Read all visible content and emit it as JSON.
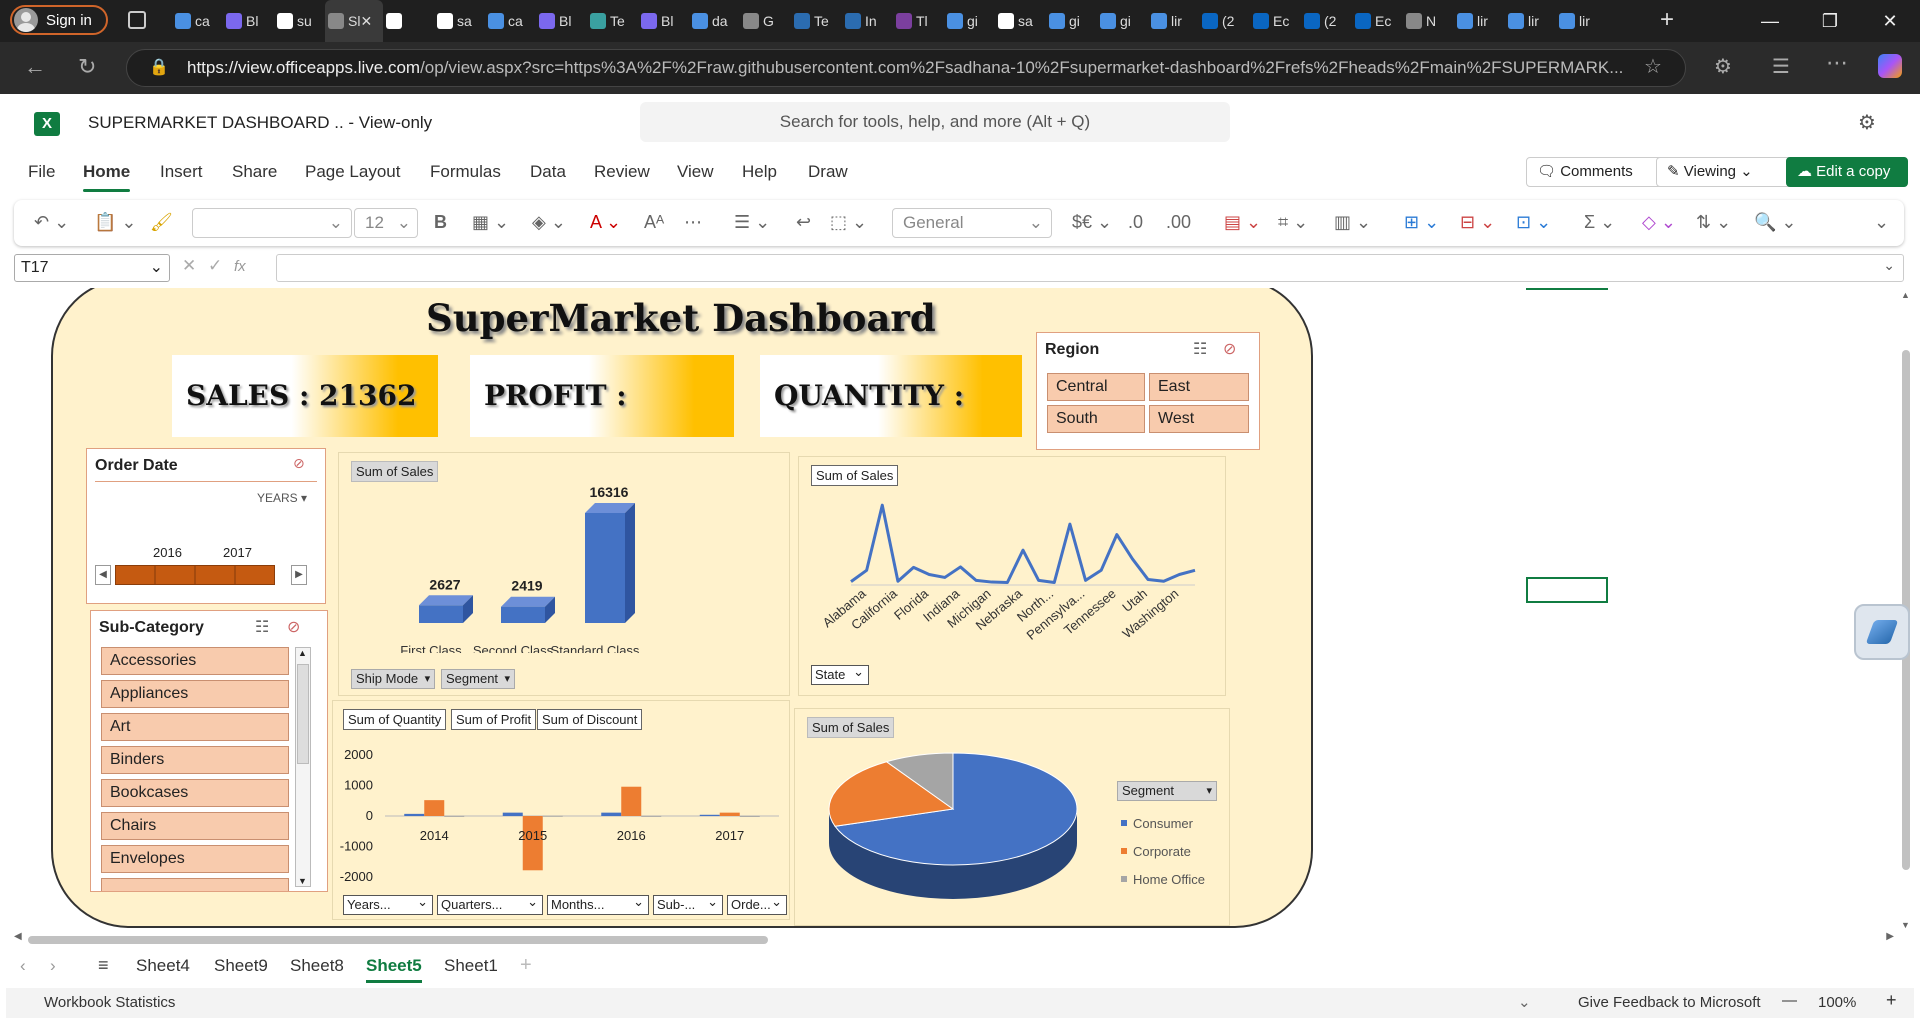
{
  "browser": {
    "signin": "Sign in",
    "tabs": [
      {
        "icon": "search-icon",
        "label": "ca",
        "color": "#4a90e2"
      },
      {
        "icon": "app-icon",
        "label": "Bl",
        "color": "#7b68ee"
      },
      {
        "icon": "github-icon",
        "label": "su",
        "color": "#ffffff"
      },
      {
        "icon": "doc-icon",
        "label": "Sl",
        "color": "#888888",
        "active": true
      },
      {
        "icon": "github-icon",
        "label": "",
        "color": "#ffffff"
      },
      {
        "icon": "github-icon",
        "label": "sa",
        "color": "#ffffff"
      },
      {
        "icon": "search-icon",
        "label": "ca",
        "color": "#4a90e2"
      },
      {
        "icon": "app-icon",
        "label": "Bl",
        "color": "#7b68ee"
      },
      {
        "icon": "app-icon",
        "label": "Te",
        "color": "#3aa0a0"
      },
      {
        "icon": "app-icon",
        "label": "Bl",
        "color": "#7b68ee"
      },
      {
        "icon": "search-icon",
        "label": "da",
        "color": "#4a90e2"
      },
      {
        "icon": "g-icon",
        "label": "G",
        "color": "#888888"
      },
      {
        "icon": "c-icon",
        "label": "Te",
        "color": "#2b6cb0"
      },
      {
        "icon": "c-icon",
        "label": "In",
        "color": "#2b6cb0"
      },
      {
        "icon": "u-icon",
        "label": "Tl",
        "color": "#7b3f9e"
      },
      {
        "icon": "search-icon",
        "label": "gi",
        "color": "#4a90e2"
      },
      {
        "icon": "github-icon",
        "label": "sa",
        "color": "#ffffff"
      },
      {
        "icon": "search-icon",
        "label": "gi",
        "color": "#4a90e2"
      },
      {
        "icon": "search-icon",
        "label": "gi",
        "color": "#4a90e2"
      },
      {
        "icon": "search-icon",
        "label": "lir",
        "color": "#4a90e2"
      },
      {
        "icon": "linkedin-icon",
        "label": "(2",
        "color": "#0a66c2"
      },
      {
        "icon": "linkedin-icon",
        "label": "Ec",
        "color": "#0a66c2"
      },
      {
        "icon": "linkedin-icon",
        "label": "(2",
        "color": "#0a66c2"
      },
      {
        "icon": "linkedin-icon",
        "label": "Ec",
        "color": "#0a66c2"
      },
      {
        "icon": "grid-icon",
        "label": "N",
        "color": "#888888"
      },
      {
        "icon": "search-icon",
        "label": "lir",
        "color": "#4a90e2"
      },
      {
        "icon": "search-icon",
        "label": "lir",
        "color": "#4a90e2"
      },
      {
        "icon": "search-icon",
        "label": "lir",
        "color": "#4a90e2"
      }
    ],
    "url_host": "https://view.officeapps.live.com",
    "url_path": "/op/view.aspx?src=https%3A%2F%2Fraw.githubusercontent.com%2Fsadhana-10%2Fsupermarket-dashboard%2Frefs%2Fheads%2Fmain%2FSUPERMARK..."
  },
  "excel": {
    "title": "SUPERMARKET DASHBOARD ..  -  View-only",
    "search_placeholder": "Search for tools, help, and more (Alt + Q)",
    "menus": [
      "File",
      "Home",
      "Insert",
      "Share",
      "Page Layout",
      "Formulas",
      "Data",
      "Review",
      "View",
      "Help",
      "Draw"
    ],
    "selected_menu": "Home",
    "comments": "Comments",
    "viewing": "Viewing",
    "edit_copy": "Edit a copy",
    "font_size": "12",
    "number_format": "General",
    "currency": "$€",
    "cell_ref": "T17",
    "fx": "fx"
  },
  "dashboard": {
    "title": "SuperMarket Dashboard",
    "kpis": {
      "sales": "SALES :  21362",
      "profit": "PROFIT :",
      "quantity": "QUANTITY :"
    },
    "region": {
      "title": "Region",
      "items": [
        "Central",
        "East",
        "South",
        "West"
      ]
    },
    "order_date": {
      "title": "Order Date",
      "level": "YEARS",
      "years": [
        "2016",
        "2017"
      ]
    },
    "sub_category": {
      "title": "Sub-Category",
      "items": [
        "Accessories",
        "Appliances",
        "Art",
        "Binders",
        "Bookcases",
        "Chairs",
        "Envelopes"
      ]
    },
    "ship_chart": {
      "tag": "Sum of Sales",
      "filters": [
        "Ship Mode",
        "Segment"
      ]
    },
    "state_chart": {
      "tag": "Sum of Sales",
      "filter": "State"
    },
    "bottom_chart": {
      "tags": [
        "Sum of Quantity",
        "Sum of Profit",
        "Sum of Discount"
      ],
      "filters": [
        "Years...",
        "Quarters...",
        "Months...",
        "Sub-...",
        "Orde..."
      ]
    },
    "pie_chart": {
      "tag": "Sum of Sales",
      "legend_title": "Segment"
    }
  },
  "chart_data": [
    {
      "type": "bar",
      "categories": [
        "First Class",
        "Second Class",
        "Standard Class"
      ],
      "values": [
        2627,
        2419,
        16316
      ],
      "colors": [
        "#4472c4"
      ]
    },
    {
      "type": "line",
      "categories": [
        "Alabama",
        "California",
        "Florida",
        "Indiana",
        "Michigan",
        "Nebraska",
        "North...",
        "Pennsylva...",
        "Tennessee",
        "Utah",
        "Washington"
      ],
      "x": [
        "",
        "Alabama",
        "",
        "California",
        "",
        "Florida",
        "",
        "Indiana",
        "",
        "Michigan",
        "",
        "Nebraska",
        "",
        "North...",
        "",
        "Pennsylva...",
        "",
        "Tennessee",
        "",
        "Utah",
        "",
        "Washington",
        ""
      ],
      "values": [
        80,
        350,
        1900,
        90,
        420,
        250,
        180,
        430,
        110,
        70,
        60,
        830,
        110,
        60,
        1450,
        110,
        350,
        1200,
        620,
        130,
        90,
        250,
        350
      ],
      "ylim": [
        0,
        2000
      ],
      "color": "#4472c4"
    },
    {
      "type": "bar",
      "categories": [
        "2014",
        "2015",
        "2016",
        "2017"
      ],
      "series": [
        {
          "name": "Sum of Quantity",
          "values": [
            70,
            110,
            110,
            40
          ],
          "color": "#4472c4"
        },
        {
          "name": "Sum of Profit",
          "values": [
            520,
            -1780,
            960,
            110
          ],
          "color": "#ed7d31"
        },
        {
          "name": "Sum of Discount",
          "values": [
            5,
            8,
            5,
            3
          ],
          "color": "#a5a5a5"
        }
      ],
      "yticks": [
        "2000",
        "1000",
        "0",
        "-1000",
        "-2000"
      ],
      "ylim": [
        -2000,
        2000
      ]
    },
    {
      "type": "pie",
      "categories": [
        "Consumer",
        "Corporate",
        "Home Office"
      ],
      "values": [
        70,
        21,
        9
      ],
      "colors": [
        "#4472c4",
        "#ed7d31",
        "#a5a5a5"
      ]
    }
  ],
  "sheets": {
    "tabs": [
      "Sheet4",
      "Sheet9",
      "Sheet8",
      "Sheet5",
      "Sheet1"
    ],
    "selected": "Sheet5"
  },
  "status": {
    "left": "Workbook Statistics",
    "feedback": "Give Feedback to Microsoft",
    "zoom": "100%"
  }
}
